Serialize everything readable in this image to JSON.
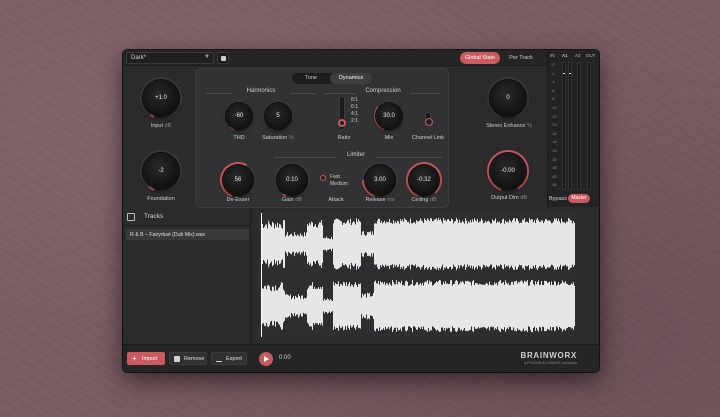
{
  "topbar": {
    "preset": "Dark*",
    "seg_global": "Global State",
    "seg_per_track": "Per Track"
  },
  "tabs": [
    "Tone",
    "Dynamics"
  ],
  "groups": {
    "harmonics": "Harmonics",
    "compression": "Compression",
    "limiter": "Limiter"
  },
  "knobs": {
    "input": {
      "value": "+1.0",
      "label": "Input",
      "unit": "dB"
    },
    "foundation": {
      "value": "-2",
      "label": "Foundation",
      "unit": ""
    },
    "thd": {
      "value": "-60",
      "label": "THD",
      "unit": ""
    },
    "saturation": {
      "value": "5",
      "label": "Saturation",
      "unit": "%"
    },
    "mix": {
      "value": "30.0",
      "label": "Mix",
      "unit": ""
    },
    "stereo": {
      "value": "0",
      "label": "Stereo Enhance",
      "unit": "%"
    },
    "deesser": {
      "value": "56",
      "label": "De-Esser",
      "unit": ""
    },
    "gain": {
      "value": "0.10",
      "label": "Gain",
      "unit": "dB"
    },
    "release": {
      "value": "3.00",
      "label": "Release",
      "unit": "ms"
    },
    "ceiling": {
      "value": "-0.32",
      "label": "Ceiling",
      "unit": "dB"
    },
    "outputdim": {
      "value": "-0.00",
      "label": "Output Dim",
      "unit": "dB"
    }
  },
  "ratio": {
    "label": "Ratio",
    "options": [
      "8:1",
      "6:1",
      "4:1",
      "2:1"
    ]
  },
  "channel_link": {
    "label": "Channel Link"
  },
  "attack": {
    "label": "Attack",
    "options": [
      "Fast",
      "Medium"
    ]
  },
  "meter": {
    "heads": [
      "IN",
      "A1",
      "A2",
      "OUT"
    ],
    "scale": [
      "-0",
      "-2",
      "-4",
      "-6",
      "-8",
      "-10",
      "-12",
      "-14",
      "-16",
      "-18",
      "-24",
      "-30",
      "-36",
      "-42",
      "-48"
    ]
  },
  "bypass": {
    "label": "Bypass",
    "master": "Master"
  },
  "tracks": {
    "title": "Tracks",
    "items": [
      "R & B – Fairydust (Dub Mix).wav"
    ]
  },
  "bottom": {
    "import": "Import",
    "remove": "Remove",
    "export": "Export",
    "time": "0:00",
    "brand": "BRAINWORX",
    "brand_sub": "a PLUGIN ALLIANCE company"
  },
  "colors": {
    "accent": "#c95a60",
    "panel": "#2b2b2d",
    "waveform": "#e6e6e6"
  }
}
